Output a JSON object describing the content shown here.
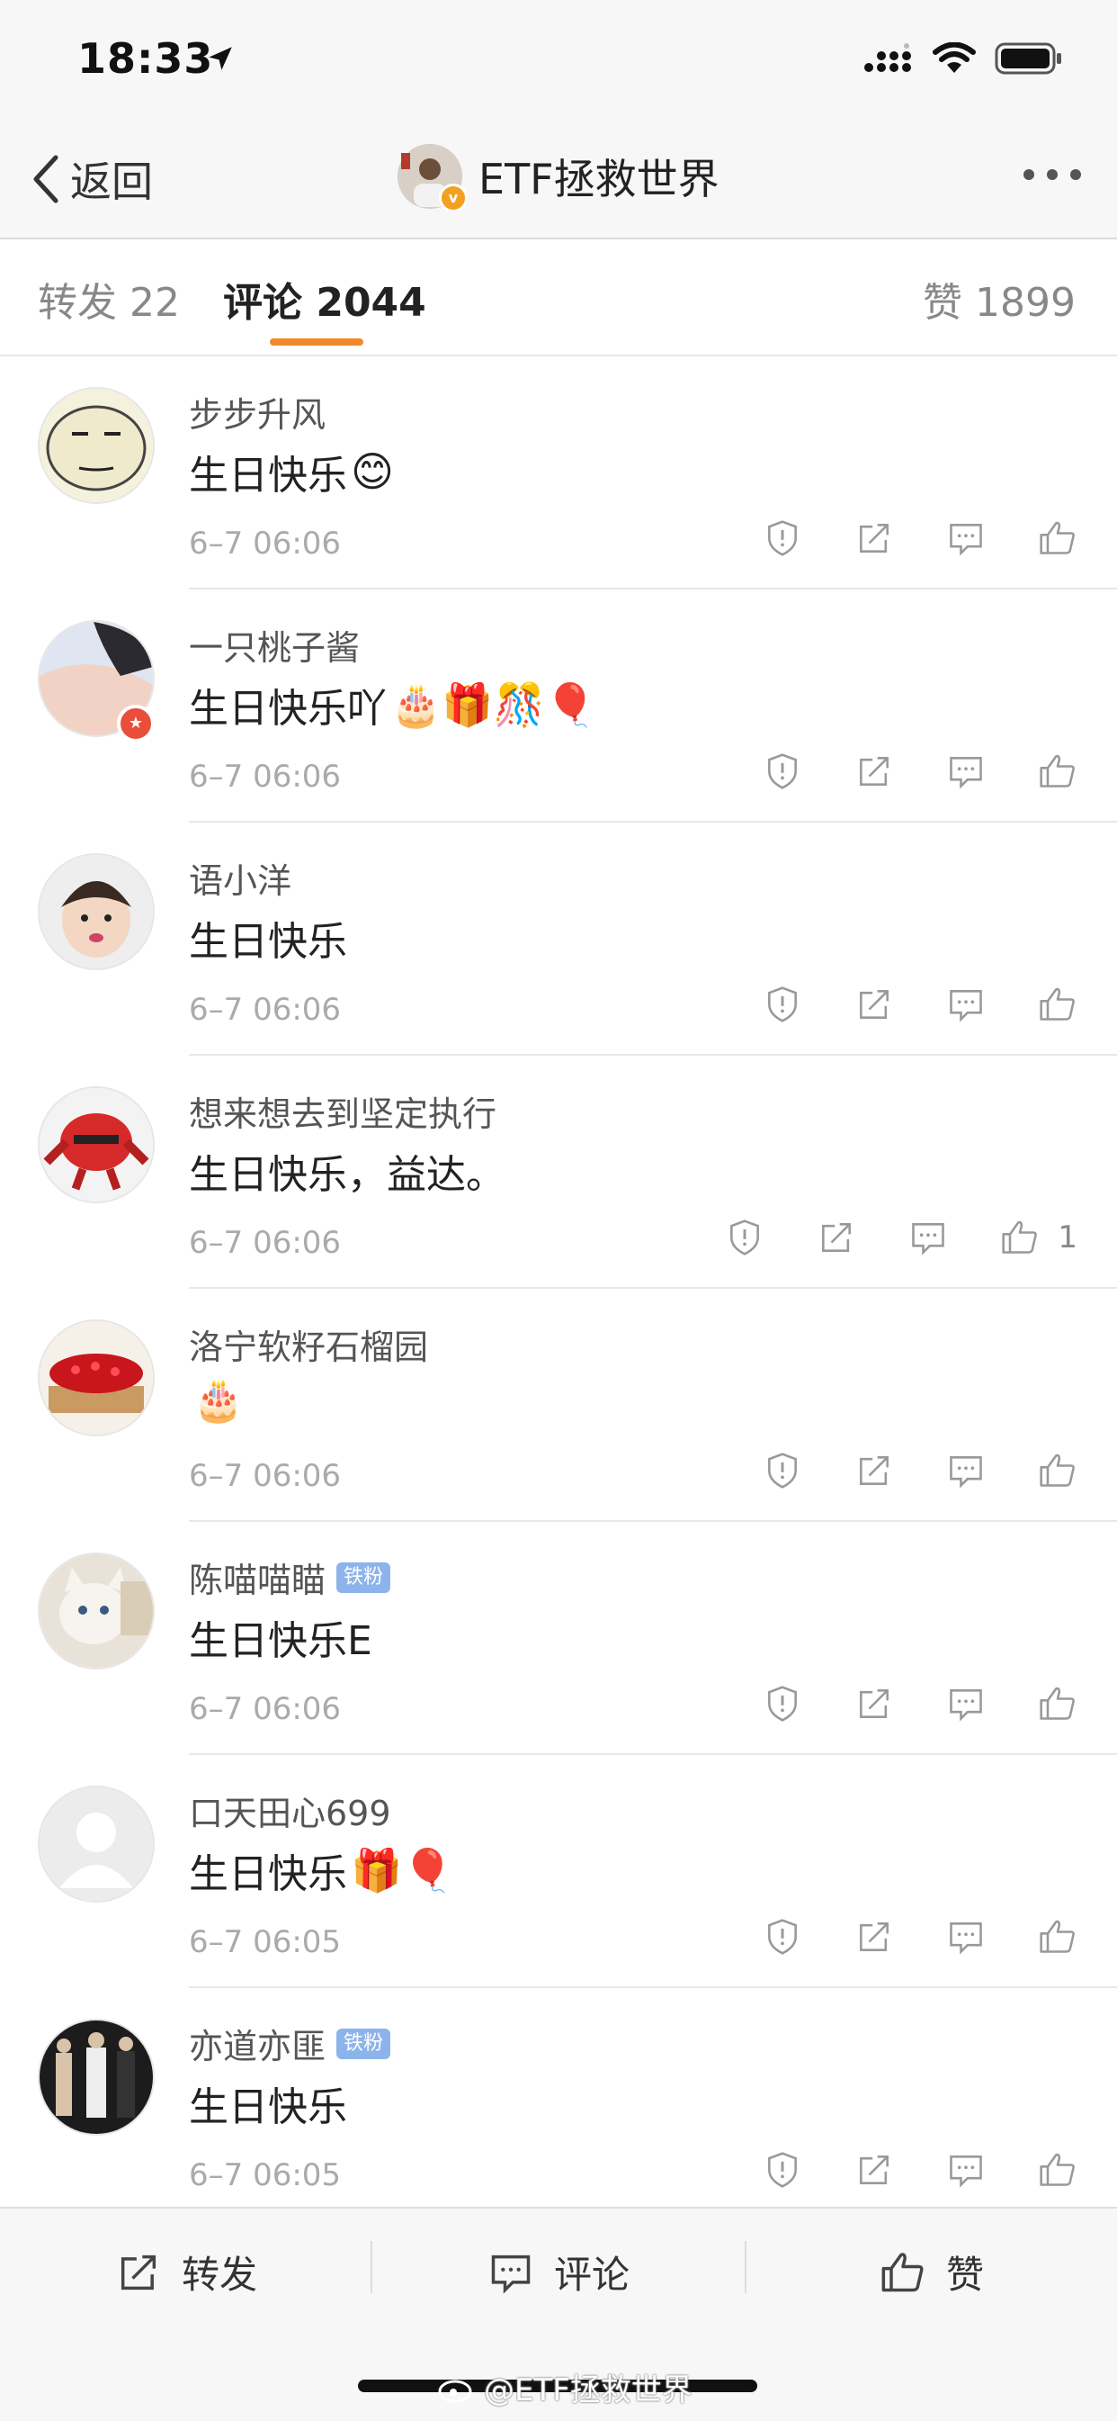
{
  "status_bar": {
    "time": "18:33"
  },
  "nav": {
    "back_label": "返回",
    "title": "ETF拯救世界",
    "verified_badge": "v"
  },
  "tabs": {
    "repost_label": "转发",
    "repost_count": "22",
    "comment_label": "评论",
    "comment_count": "2044",
    "like_label": "赞",
    "like_count": "1899"
  },
  "colors": {
    "accent": "#f0892a",
    "fan_badge": "#8db4ea"
  },
  "comments": [
    {
      "user": "步步升风",
      "text": "生日快乐",
      "emojis": "😊",
      "time": "6–7 06:06",
      "likes": ""
    },
    {
      "user": "一只桃子酱",
      "text": "生日快乐吖",
      "emojis": "🎂🎁🎊🎈",
      "time": "6–7 06:06",
      "likes": ""
    },
    {
      "user": "语小洋",
      "text": "生日快乐",
      "emojis": "",
      "time": "6–7 06:06",
      "likes": ""
    },
    {
      "user": "想来想去到坚定执行",
      "text": "生日快乐，益达。",
      "emojis": "",
      "time": "6–7 06:06",
      "likes": "1"
    },
    {
      "user": "洛宁软籽石榴园",
      "text": "",
      "emojis": "🎂",
      "time": "6–7 06:06",
      "likes": ""
    },
    {
      "user": "陈喵喵瞄",
      "badge": "铁粉",
      "text": "生日快乐E",
      "emojis": "",
      "time": "6–7 06:06",
      "likes": ""
    },
    {
      "user": "口天田心699",
      "text": "生日快乐",
      "emojis": "🎁🎈",
      "time": "6–7 06:05",
      "likes": ""
    },
    {
      "user": "亦道亦匪",
      "badge": "铁粉",
      "text": "生日快乐",
      "emojis": "",
      "time": "6–7 06:05",
      "likes": ""
    }
  ],
  "bottom_bar": {
    "repost": "转发",
    "comment": "评论",
    "like": "赞"
  },
  "watermark": "@ETF拯救世界"
}
